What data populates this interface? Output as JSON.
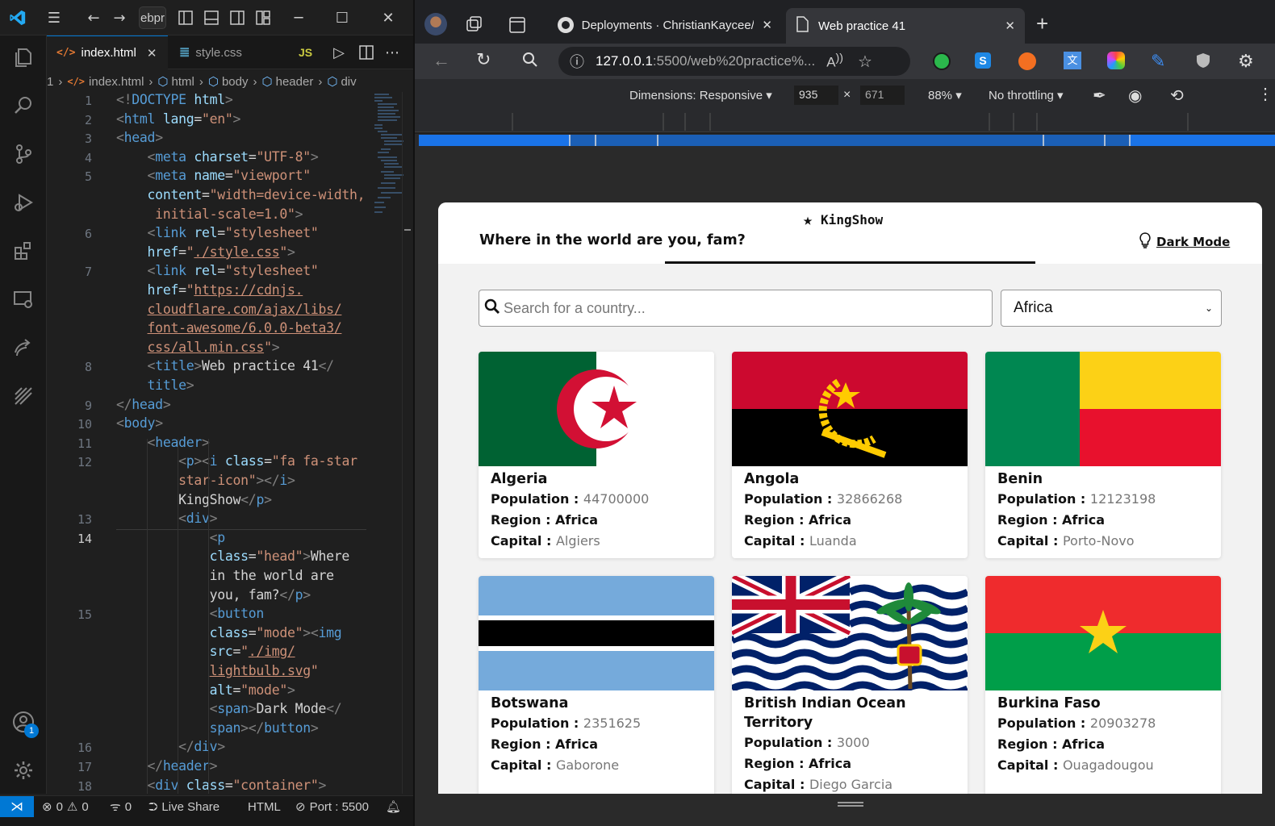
{
  "vscode": {
    "title_fragment": "ebpr",
    "tabs": [
      {
        "label": "index.html",
        "icon": "html-icon",
        "active": true
      },
      {
        "label": "style.css",
        "icon": "css-icon",
        "active": false
      },
      {
        "label": "JS",
        "icon": "js-icon",
        "active": false
      }
    ],
    "breadcrumb": [
      "1",
      "index.html",
      "html",
      "body",
      "header",
      "div"
    ],
    "code_lines": [
      {
        "n": "1",
        "segs": [
          [
            "tg",
            "<!"
          ],
          [
            "tn",
            "DOCTYPE"
          ],
          [
            "at",
            " html"
          ],
          [
            "tg",
            ">"
          ]
        ]
      },
      {
        "n": "2",
        "segs": [
          [
            "tg",
            "<"
          ],
          [
            "tn",
            "html"
          ],
          [
            "at",
            " lang"
          ],
          [
            "tx",
            "="
          ],
          [
            "st",
            "\"en\""
          ],
          [
            "tg",
            ">"
          ]
        ]
      },
      {
        "n": "3",
        "segs": [
          [
            "tg",
            "<"
          ],
          [
            "tn",
            "head"
          ],
          [
            "tg",
            ">"
          ]
        ]
      },
      {
        "n": "4",
        "segs": [
          [
            "tx",
            "    "
          ],
          [
            "tg",
            "<"
          ],
          [
            "tn",
            "meta"
          ],
          [
            "at",
            " charset"
          ],
          [
            "tx",
            "="
          ],
          [
            "st",
            "\"UTF-8\""
          ],
          [
            "tg",
            ">"
          ]
        ]
      },
      {
        "n": "5",
        "segs": [
          [
            "tx",
            "    "
          ],
          [
            "tg",
            "<"
          ],
          [
            "tn",
            "meta"
          ],
          [
            "at",
            " name"
          ],
          [
            "tx",
            "="
          ],
          [
            "st",
            "\"viewport\""
          ]
        ]
      },
      {
        "n": "",
        "segs": [
          [
            "tx",
            "    "
          ],
          [
            "at",
            "content"
          ],
          [
            "tx",
            "="
          ],
          [
            "st",
            "\"width=device-width,"
          ]
        ]
      },
      {
        "n": "",
        "segs": [
          [
            "tx",
            "     "
          ],
          [
            "st",
            "initial-scale=1.0\""
          ],
          [
            "tg",
            ">"
          ]
        ]
      },
      {
        "n": "6",
        "segs": [
          [
            "tx",
            "    "
          ],
          [
            "tg",
            "<"
          ],
          [
            "tn",
            "link"
          ],
          [
            "at",
            " rel"
          ],
          [
            "tx",
            "="
          ],
          [
            "st",
            "\"stylesheet\""
          ]
        ]
      },
      {
        "n": "",
        "segs": [
          [
            "tx",
            "    "
          ],
          [
            "at",
            "href"
          ],
          [
            "tx",
            "="
          ],
          [
            "st",
            "\""
          ],
          [
            "stu",
            "./style.css"
          ],
          [
            "st",
            "\""
          ],
          [
            "tg",
            ">"
          ]
        ]
      },
      {
        "n": "7",
        "segs": [
          [
            "tx",
            "    "
          ],
          [
            "tg",
            "<"
          ],
          [
            "tn",
            "link"
          ],
          [
            "at",
            " rel"
          ],
          [
            "tx",
            "="
          ],
          [
            "st",
            "\"stylesheet\""
          ]
        ]
      },
      {
        "n": "",
        "segs": [
          [
            "tx",
            "    "
          ],
          [
            "at",
            "href"
          ],
          [
            "tx",
            "="
          ],
          [
            "st",
            "\""
          ],
          [
            "stu",
            "https://cdnjs."
          ]
        ]
      },
      {
        "n": "",
        "segs": [
          [
            "tx",
            "    "
          ],
          [
            "stu",
            "cloudflare.com/ajax/libs/"
          ]
        ]
      },
      {
        "n": "",
        "segs": [
          [
            "tx",
            "    "
          ],
          [
            "stu",
            "font-awesome/6.0.0-beta3/"
          ]
        ]
      },
      {
        "n": "",
        "segs": [
          [
            "tx",
            "    "
          ],
          [
            "stu",
            "css/all.min.css"
          ],
          [
            "st",
            "\""
          ],
          [
            "tg",
            ">"
          ]
        ]
      },
      {
        "n": "8",
        "segs": [
          [
            "tx",
            "    "
          ],
          [
            "tg",
            "<"
          ],
          [
            "tn",
            "title"
          ],
          [
            "tg",
            ">"
          ],
          [
            "tx",
            "Web practice 41"
          ],
          [
            "tg",
            "</"
          ]
        ]
      },
      {
        "n": "",
        "segs": [
          [
            "tx",
            "    "
          ],
          [
            "tn",
            "title"
          ],
          [
            "tg",
            ">"
          ]
        ]
      },
      {
        "n": "9",
        "segs": [
          [
            "tg",
            "</"
          ],
          [
            "tn",
            "head"
          ],
          [
            "tg",
            ">"
          ]
        ]
      },
      {
        "n": "10",
        "segs": [
          [
            "tg",
            "<"
          ],
          [
            "tn",
            "body"
          ],
          [
            "tg",
            ">"
          ]
        ]
      },
      {
        "n": "11",
        "segs": [
          [
            "tx",
            "    "
          ],
          [
            "tg",
            "<"
          ],
          [
            "tn",
            "header"
          ],
          [
            "tg",
            ">"
          ]
        ]
      },
      {
        "n": "12",
        "segs": [
          [
            "tx",
            "        "
          ],
          [
            "tg",
            "<"
          ],
          [
            "tn",
            "p"
          ],
          [
            "tg",
            "><"
          ],
          [
            "tn",
            "i"
          ],
          [
            "at",
            " class"
          ],
          [
            "tx",
            "="
          ],
          [
            "st",
            "\"fa fa-star"
          ]
        ]
      },
      {
        "n": "",
        "segs": [
          [
            "tx",
            "        "
          ],
          [
            "st",
            "star-icon\""
          ],
          [
            "tg",
            "></"
          ],
          [
            "tn",
            "i"
          ],
          [
            "tg",
            ">"
          ]
        ]
      },
      {
        "n": "",
        "segs": [
          [
            "tx",
            "        KingShow"
          ],
          [
            "tg",
            "</"
          ],
          [
            "tn",
            "p"
          ],
          [
            "tg",
            ">"
          ]
        ]
      },
      {
        "n": "13",
        "segs": [
          [
            "tx",
            "        "
          ],
          [
            "tg",
            "<"
          ],
          [
            "tn",
            "div"
          ],
          [
            "tg",
            ">"
          ]
        ]
      },
      {
        "n": "14",
        "segs": [
          [
            "tx",
            "            "
          ],
          [
            "tg",
            "<"
          ],
          [
            "tn",
            "p"
          ]
        ]
      },
      {
        "n": "",
        "segs": [
          [
            "tx",
            "            "
          ],
          [
            "at",
            "class"
          ],
          [
            "tx",
            "="
          ],
          [
            "st",
            "\"head\""
          ],
          [
            "tg",
            ">"
          ],
          [
            "tx",
            "Where"
          ]
        ]
      },
      {
        "n": "",
        "segs": [
          [
            "tx",
            "            in the world are"
          ]
        ]
      },
      {
        "n": "",
        "segs": [
          [
            "tx",
            "            you, fam?"
          ],
          [
            "tg",
            "</"
          ],
          [
            "tn",
            "p"
          ],
          [
            "tg",
            ">"
          ]
        ]
      },
      {
        "n": "15",
        "segs": [
          [
            "tx",
            "            "
          ],
          [
            "tg",
            "<"
          ],
          [
            "tn",
            "button"
          ]
        ]
      },
      {
        "n": "",
        "segs": [
          [
            "tx",
            "            "
          ],
          [
            "at",
            "class"
          ],
          [
            "tx",
            "="
          ],
          [
            "st",
            "\"mode\""
          ],
          [
            "tg",
            "><"
          ],
          [
            "tn",
            "img"
          ]
        ]
      },
      {
        "n": "",
        "segs": [
          [
            "tx",
            "            "
          ],
          [
            "at",
            "src"
          ],
          [
            "tx",
            "="
          ],
          [
            "st",
            "\""
          ],
          [
            "stu",
            "./img/"
          ]
        ]
      },
      {
        "n": "",
        "segs": [
          [
            "tx",
            "            "
          ],
          [
            "stu",
            "lightbulb.svg"
          ],
          [
            "st",
            "\""
          ]
        ]
      },
      {
        "n": "",
        "segs": [
          [
            "tx",
            "            "
          ],
          [
            "at",
            "alt"
          ],
          [
            "tx",
            "="
          ],
          [
            "st",
            "\"mode\""
          ],
          [
            "tg",
            ">"
          ]
        ]
      },
      {
        "n": "",
        "segs": [
          [
            "tx",
            "            "
          ],
          [
            "tg",
            "<"
          ],
          [
            "tn",
            "span"
          ],
          [
            "tg",
            ">"
          ],
          [
            "tx",
            "Dark Mode"
          ],
          [
            "tg",
            "</"
          ]
        ]
      },
      {
        "n": "",
        "segs": [
          [
            "tx",
            "            "
          ],
          [
            "tn",
            "span"
          ],
          [
            "tg",
            "></"
          ],
          [
            "tn",
            "button"
          ],
          [
            "tg",
            ">"
          ]
        ]
      },
      {
        "n": "16",
        "segs": [
          [
            "tx",
            "        "
          ],
          [
            "tg",
            "</"
          ],
          [
            "tn",
            "div"
          ],
          [
            "tg",
            ">"
          ]
        ]
      },
      {
        "n": "17",
        "segs": [
          [
            "tx",
            "    "
          ],
          [
            "tg",
            "</"
          ],
          [
            "tn",
            "header"
          ],
          [
            "tg",
            ">"
          ]
        ]
      },
      {
        "n": "18",
        "segs": [
          [
            "tx",
            "    "
          ],
          [
            "tg",
            "<"
          ],
          [
            "tn",
            "div"
          ],
          [
            "at",
            " class"
          ],
          [
            "tx",
            "="
          ],
          [
            "st",
            "\"container\""
          ],
          [
            "tg",
            ">"
          ]
        ]
      }
    ],
    "active_line": "14",
    "status": {
      "errors": "0",
      "warnings": "0",
      "ports": "0",
      "live_share": "Live Share",
      "language": "HTML",
      "port": "Port : 5500",
      "account_badge": "1"
    }
  },
  "browser": {
    "tabs": [
      {
        "title": "Deployments · ChristianKaycee/S",
        "active": false
      },
      {
        "title": "Web practice 41",
        "active": true
      }
    ],
    "url_host": "127.0.0.1",
    "url_rest": ":5500/web%20practice%...",
    "devtools": {
      "dimensions": "Dimensions: Responsive",
      "width": "935",
      "times": "×",
      "height": "671",
      "zoom": "88%",
      "throttling": "No throttling"
    }
  },
  "page": {
    "brand": "KingShow",
    "headline": "Where in the world are you, fam?",
    "dark_mode": "Dark Mode",
    "search_placeholder": "Search for a country...",
    "region_selected": "Africa",
    "labels": {
      "population": "Population :",
      "region": "Region :",
      "capital": "Capital :"
    },
    "countries": [
      {
        "name": "Algeria",
        "population": "44700000",
        "region": "Africa",
        "capital": "Algiers",
        "flag": "algeria-flag"
      },
      {
        "name": "Angola",
        "population": "32866268",
        "region": "Africa",
        "capital": "Luanda",
        "flag": "angola-flag"
      },
      {
        "name": "Benin",
        "population": "12123198",
        "region": "Africa",
        "capital": "Porto-Novo",
        "flag": "benin-flag"
      },
      {
        "name": "Botswana",
        "population": "2351625",
        "region": "Africa",
        "capital": "Gaborone",
        "flag": "botswana-flag"
      },
      {
        "name": "British Indian Ocean Territory",
        "population": "3000",
        "region": "Africa",
        "capital": "Diego Garcia",
        "flag": "biot-flag"
      },
      {
        "name": "Burkina Faso",
        "population": "20903278",
        "region": "Africa",
        "capital": "Ouagadougou",
        "flag": "burkina-faso-flag"
      }
    ]
  },
  "colors": {
    "vscode_accent": "#0078d4",
    "page_bg": "#f2f2f2",
    "card_bg": "#ffffff",
    "link_blue": "#1a73e8"
  }
}
